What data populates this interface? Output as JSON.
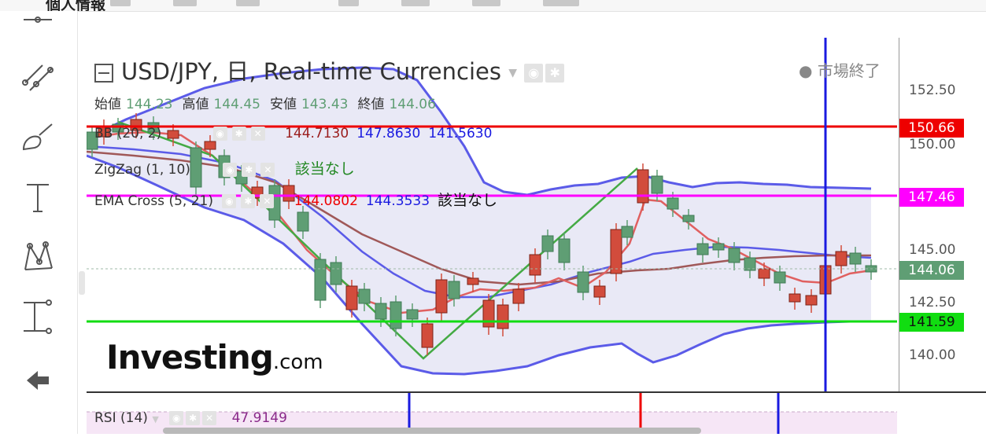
{
  "top_strip": {
    "title": "個人情報"
  },
  "chart": {
    "symbol": "USD/JPY",
    "interval": "日",
    "source": "Real-time Currencies",
    "market_status": "市場終了",
    "ohlc": {
      "open_label": "始値",
      "open": "144.23",
      "high_label": "高値",
      "high": "144.45",
      "low_label": "安値",
      "low": "143.43",
      "close_label": "終値",
      "close": "144.06"
    },
    "indicators": {
      "bb": {
        "label": "BB (20, 2)",
        "v1": "144.7130",
        "v2": "147.8630",
        "v3": "141.5630"
      },
      "zigzag": {
        "label": "ZigZag (1, 10)",
        "value": "該当なし"
      },
      "ema": {
        "label": "EMA Cross (5, 21)",
        "v1": "144.0802",
        "v2": "144.3533",
        "v3": "該当なし"
      }
    },
    "price_axis": {
      "ticks": [
        "152.50",
        "150.00",
        "145.00",
        "142.50",
        "140.00"
      ],
      "tags": [
        {
          "value": "150.66",
          "color": "#ee0000"
        },
        {
          "value": "147.46",
          "color": "#ff00ff"
        },
        {
          "value": "144.06",
          "color": "#5f9e74"
        },
        {
          "value": "141.59",
          "color": "#11dd11"
        }
      ]
    },
    "logo": {
      "main": "Investing",
      "suffix": ".com"
    },
    "colors": {
      "up": "#5f9e74",
      "down": "#d24c3c",
      "bb_band": "#5b5be8",
      "bb_fill": "#e9e9f6",
      "ema_fast": "#e06060",
      "ema_slow": "#a05858",
      "zigzag": "#44aa44",
      "hline_red": "#ee0000",
      "hline_magenta": "#ff00ff",
      "hline_green": "#11dd11",
      "vline": "#1a1ae0"
    }
  },
  "rsi": {
    "label": "RSI (14)",
    "value": "47.9149"
  },
  "tools": [
    "crosshair-icon",
    "trend-line-icon",
    "brush-icon",
    "text-icon",
    "pattern-icon",
    "measure-icon",
    "back-arrow-icon"
  ]
}
